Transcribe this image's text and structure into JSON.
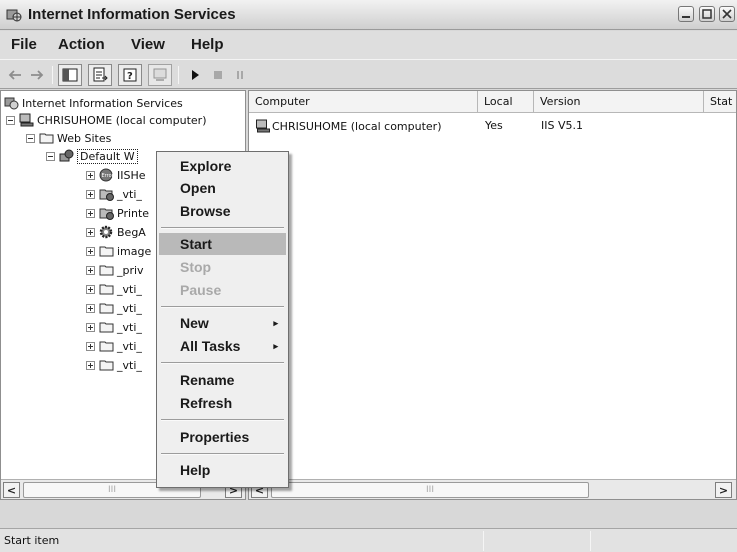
{
  "window": {
    "title": "Internet Information Services"
  },
  "menubar": {
    "items": [
      "File",
      "Action",
      "View",
      "Help"
    ]
  },
  "toolbar": {
    "buttons": [
      "back-arrow",
      "forward-arrow",
      "show-console-tree",
      "export-list",
      "help",
      "connect-computer",
      "start-item",
      "stop-item",
      "pause-item"
    ]
  },
  "tree": {
    "items": [
      {
        "label": "Internet Information Services",
        "icon": "iis-icon"
      },
      {
        "label": "CHRISUHOME (local computer)",
        "icon": "computer-icon"
      },
      {
        "label": "Web Sites",
        "icon": "folder-icon"
      },
      {
        "label": "Default W",
        "icon": "website-icon"
      },
      {
        "label": "IISHe",
        "icon": "error-icon"
      },
      {
        "label": "_vti_",
        "icon": "virtual-dir-icon"
      },
      {
        "label": "Printe",
        "icon": "virtual-dir-icon"
      },
      {
        "label": "BegA",
        "icon": "gear-icon"
      },
      {
        "label": "image",
        "icon": "folder-icon"
      },
      {
        "label": "_priv",
        "icon": "folder-icon"
      },
      {
        "label": "_vti_",
        "icon": "folder-icon"
      },
      {
        "label": "_vti_",
        "icon": "folder-icon"
      },
      {
        "label": "_vti_",
        "icon": "folder-icon"
      },
      {
        "label": "_vti_",
        "icon": "folder-icon"
      },
      {
        "label": "_vti_",
        "icon": "folder-icon"
      }
    ]
  },
  "list": {
    "columns": [
      "Computer",
      "Local",
      "Version",
      "Stat"
    ],
    "rows": [
      {
        "computer": "CHRISUHOME (local computer)",
        "local": "Yes",
        "version": "IIS V5.1",
        "status": ""
      }
    ]
  },
  "context_menu": {
    "items": [
      "Explore",
      "Open",
      "Browse",
      "Start",
      "Stop",
      "Pause",
      "New",
      "All Tasks",
      "Rename",
      "Refresh",
      "Properties",
      "Help"
    ],
    "highlighted": "Start",
    "disabled": [
      "Stop",
      "Pause"
    ],
    "submenu_arrow": "▸"
  },
  "scroll": {
    "left": "<",
    "right": ">",
    "grip": "III"
  },
  "statusbar": {
    "text": "Start item"
  },
  "colors": {
    "highlight": "#b9b9b9",
    "disabled_text": "#a9a9a9",
    "pane_background": "#ffffff"
  }
}
